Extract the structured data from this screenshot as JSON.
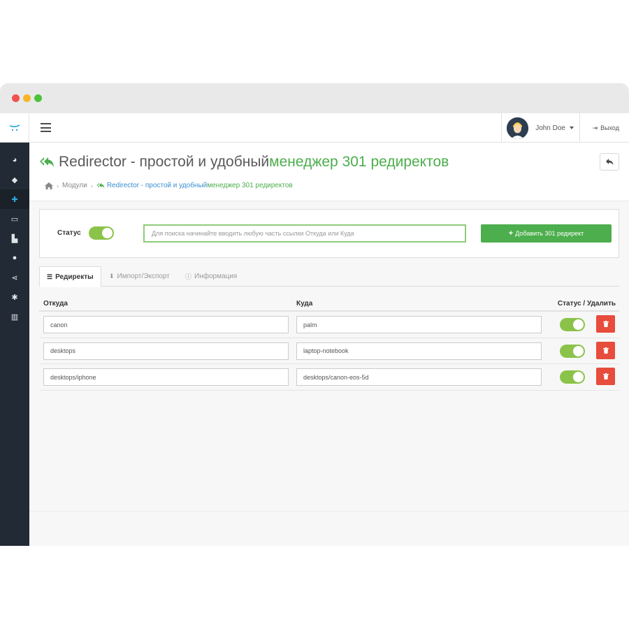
{
  "window": {
    "traffic_lights": [
      "close",
      "minimize",
      "maximize"
    ]
  },
  "sidebar": {
    "logo_icon": "opencart-cart-logo",
    "items": [
      {
        "icon": "dashboard-icon",
        "glyph": "◕",
        "active": false
      },
      {
        "icon": "tags-icon",
        "glyph": "◆",
        "active": false
      },
      {
        "icon": "puzzle-icon",
        "glyph": "✚",
        "active": true
      },
      {
        "icon": "desktop-icon",
        "glyph": "▭",
        "active": false
      },
      {
        "icon": "shopping-cart-icon",
        "glyph": "▙",
        "active": false
      },
      {
        "icon": "user-icon",
        "glyph": "●",
        "active": false
      },
      {
        "icon": "share-icon",
        "glyph": "⋖",
        "active": false
      },
      {
        "icon": "cog-icon",
        "glyph": "✱",
        "active": false
      },
      {
        "icon": "bar-chart-icon",
        "glyph": "▥",
        "active": false
      }
    ]
  },
  "topbar": {
    "user_name": "John Doe",
    "logout_label": "Выход"
  },
  "header": {
    "title_prefix": "Redirector - простой и удобный ",
    "title_highlight": "менеджер 301 редиректов",
    "breadcrumb": {
      "modules": "Модули",
      "current_prefix": "Redirector - простой и удобный ",
      "current_highlight": "менеджер 301 редиректов"
    }
  },
  "toolbar": {
    "status_label": "Статус",
    "status_on": true,
    "search_placeholder": "Для поиска начинайте вводить любую часть ссылки Откуда или Куда",
    "add_button_label": "Добавить 301 редирект"
  },
  "tabs": [
    {
      "label": "Редиректы",
      "active": true
    },
    {
      "label": "Импорт/Экспорт",
      "active": false
    },
    {
      "label": "Информация",
      "active": false
    }
  ],
  "table": {
    "headers": {
      "from": "Откуда",
      "to": "Куда",
      "actions": "Статус / Удалить"
    },
    "rows": [
      {
        "from": "canon",
        "to": "palm",
        "enabled": true
      },
      {
        "from": "desktops",
        "to": "laptop-notebook",
        "enabled": true
      },
      {
        "from": "desktops/iphone",
        "to": "desktops/canon-eos-5d",
        "enabled": true
      }
    ]
  },
  "colors": {
    "accent_green": "#4cae4c",
    "toggle_green": "#8bc34a",
    "danger_red": "#e74c3c",
    "sidebar_bg": "#222b35",
    "link_blue": "#3a8fd0"
  }
}
